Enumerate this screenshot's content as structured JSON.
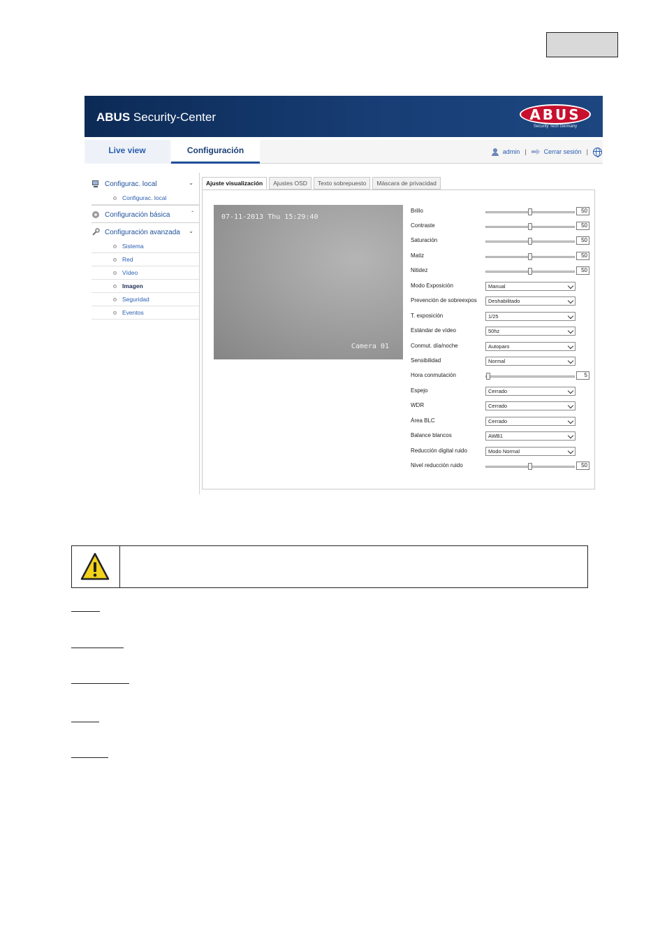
{
  "app": {
    "banner_brand": "ABUS",
    "banner_rest": " Security-Center",
    "logo_text": "ABUS",
    "logo_subtitle": "Security Tech Germany"
  },
  "nav": {
    "tabs": [
      "Live view",
      "Configuración"
    ],
    "user": "admin",
    "logout": "Cerrar sesión"
  },
  "sidebar": {
    "groups": [
      {
        "label": "Configurac. local",
        "items": [
          "Configurac. local"
        ]
      },
      {
        "label": "Configuración básica",
        "items": []
      },
      {
        "label": "Configuración avanzada",
        "items": [
          "Sistema",
          "Red",
          "Vídeo",
          "Imagen",
          "Seguridad",
          "Eventos"
        ]
      }
    ],
    "active_item": "Imagen"
  },
  "tabs": [
    "Ajuste visualización",
    "Ajustes OSD",
    "Texto sobrepuesto",
    "Máscara de privacidad"
  ],
  "video": {
    "timestamp": "07-11-2013 Thu 15:29:40",
    "camera_name": "Camera 01"
  },
  "settings": {
    "brillo": {
      "label": "Brillo",
      "value": "50"
    },
    "contraste": {
      "label": "Contraste",
      "value": "50"
    },
    "saturacion": {
      "label": "Saturación",
      "value": "50"
    },
    "matiz": {
      "label": "Matiz",
      "value": "50"
    },
    "nitidez": {
      "label": "Nitidez",
      "value": "50"
    },
    "modo_exposicion": {
      "label": "Modo Exposición",
      "value": "Manual"
    },
    "prevencion": {
      "label": "Prevención de sobreexpos",
      "value": "Deshabilitado"
    },
    "t_exposicion": {
      "label": "T. exposición",
      "value": "1/25"
    },
    "estandar_video": {
      "label": "Estándar de vídeo",
      "value": "50hz"
    },
    "conmut": {
      "label": "Conmut. día/noche",
      "value": "Autoparo"
    },
    "sensibilidad": {
      "label": "Sensibilidad",
      "value": "Normal"
    },
    "hora_conmutacion": {
      "label": "Hora conmutación",
      "value": "5"
    },
    "espejo": {
      "label": "Espejo",
      "value": "Cerrado"
    },
    "wdr": {
      "label": "WDR",
      "value": "Cerrado"
    },
    "area_blc": {
      "label": "Área BLC",
      "value": "Cerrado"
    },
    "balance": {
      "label": "Balance blancos",
      "value": "AWB1"
    },
    "reduccion": {
      "label": "Reducción digital ruido",
      "value": "Modo Normal"
    },
    "nivel_reduccion": {
      "label": "Nivel reducción ruido",
      "value": "50"
    }
  },
  "slider_levels": {
    "brillo": 0.5,
    "contraste": 0.5,
    "saturacion": 0.5,
    "matiz": 0.5,
    "nitidez": 0.5,
    "hora_conmutacion": 0.0,
    "nivel_reduccion": 0.5
  },
  "colors": {
    "banner": "#173d74",
    "link": "#2a5db0",
    "logo_red": "#c8102e",
    "warning_yellow": "#f2d21b"
  }
}
